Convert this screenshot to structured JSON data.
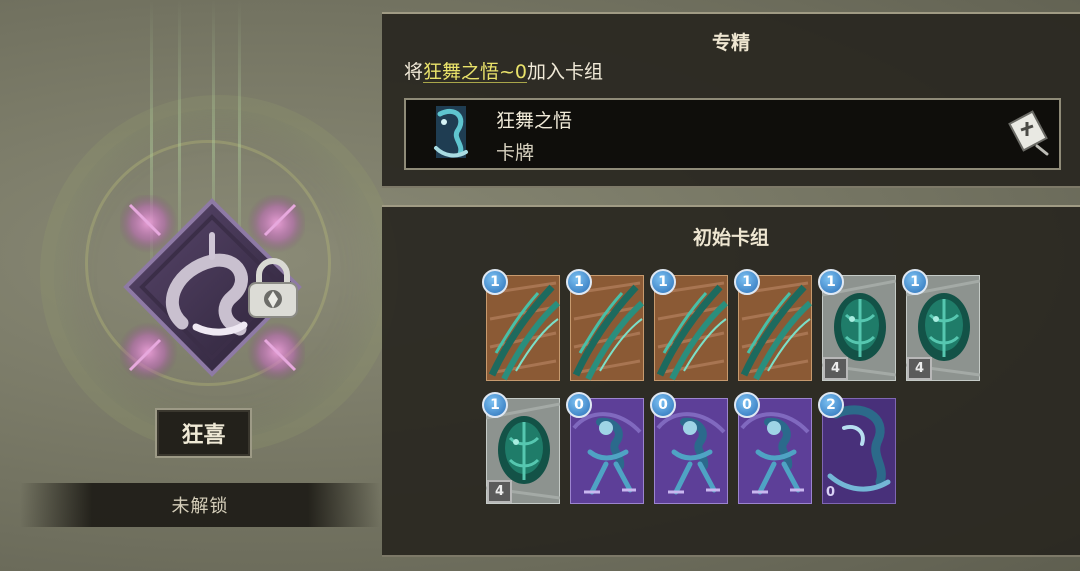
{
  "specialization": {
    "title": "专精",
    "desc_prefix": "将",
    "desc_highlight": "狂舞之悟~0",
    "desc_suffix": "加入卡组",
    "card": {
      "name": "狂舞之悟",
      "type": "卡牌"
    }
  },
  "deck": {
    "title": "初始卡组",
    "cards": [
      {
        "cost": "1",
        "art": "claw-attack"
      },
      {
        "cost": "1",
        "art": "claw-attack"
      },
      {
        "cost": "1",
        "art": "claw-attack"
      },
      {
        "cost": "1",
        "art": "claw-attack"
      },
      {
        "cost": "1",
        "art": "carapace-defend",
        "count": "4"
      },
      {
        "cost": "1",
        "art": "carapace-defend",
        "count": "4"
      },
      {
        "cost": "1",
        "art": "carapace-defend",
        "count": "4"
      },
      {
        "cost": "0",
        "art": "purple-dancer"
      },
      {
        "cost": "0",
        "art": "purple-dancer"
      },
      {
        "cost": "0",
        "art": "purple-dancer"
      },
      {
        "cost": "2",
        "art": "purple-rune",
        "corner_num": "0"
      }
    ]
  },
  "character": {
    "name": "狂喜",
    "status": "未解锁"
  },
  "colors": {
    "highlight": "#e9e26a",
    "cost_badge": "#3b86cf",
    "attack_card_bg": "#8e5e38",
    "defend_card_bg": "#8e9490",
    "skill_card_bg": "#5f4099",
    "panel_bg": "#28261f"
  }
}
